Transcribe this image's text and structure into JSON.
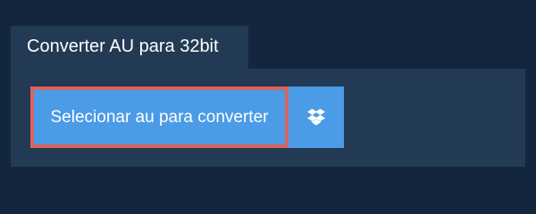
{
  "tab": {
    "title": "Converter AU para 32bit"
  },
  "upload": {
    "select_label": "Selecionar au para converter",
    "dropbox_icon": "dropbox-icon"
  },
  "colors": {
    "page_background": "#14263d",
    "panel_background": "#233a54",
    "button_background": "#4b9be6",
    "button_focus_border": "#d9635f",
    "text": "#ffffff"
  }
}
